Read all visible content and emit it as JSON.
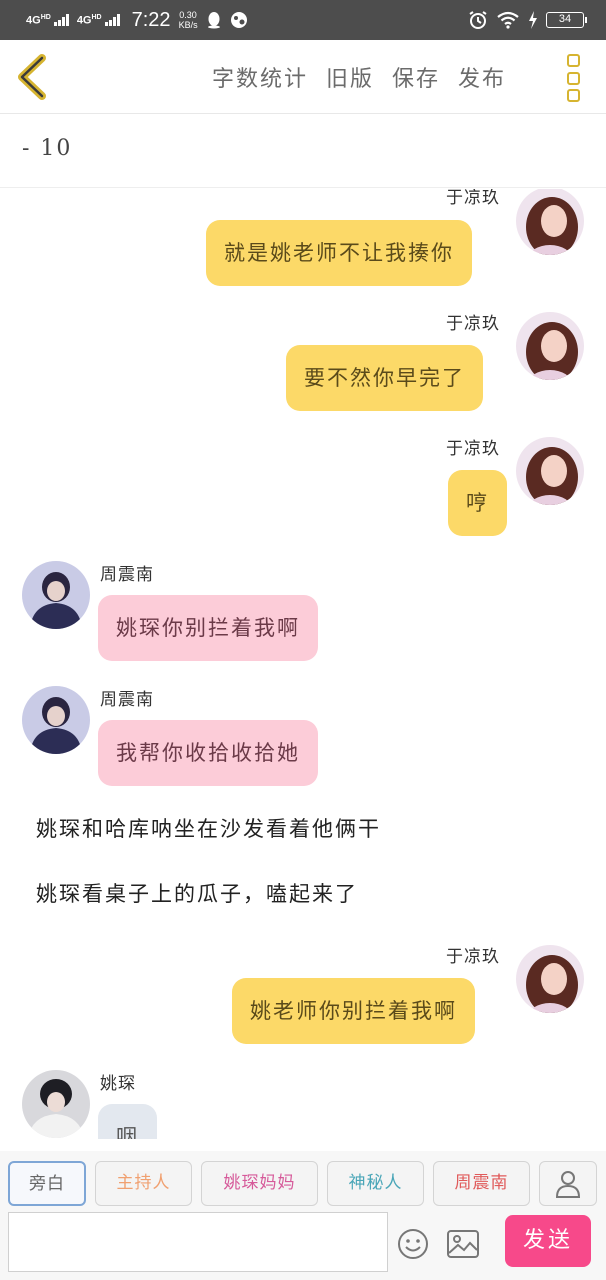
{
  "status_bar": {
    "network_1": "4G",
    "network_1_sup": "HD",
    "network_2": "4G",
    "network_2_sup": "HD",
    "time": "7:22",
    "speed_value": "0.30",
    "speed_unit": "KB/s",
    "battery": "34"
  },
  "nav": {
    "word_count": "字数统计",
    "old_version": "旧版",
    "save": "保存",
    "publish": "发布"
  },
  "title_field": {
    "value": "- 10"
  },
  "colors": {
    "accent": "#fcd968",
    "pink": "#fcccd8",
    "send": "#f7498a",
    "menu": "#d6b430"
  },
  "messages": [
    {
      "speaker": "于凉玖",
      "text": "就是姚老师不让我揍你",
      "side": "right"
    },
    {
      "speaker": "于凉玖",
      "text": "要不然你早完了",
      "side": "right"
    },
    {
      "speaker": "于凉玖",
      "text": "哼",
      "side": "right"
    },
    {
      "speaker": "周震南",
      "text": "姚琛你别拦着我啊",
      "side": "left"
    },
    {
      "speaker": "周震南",
      "text": "我帮你收拾收拾她",
      "side": "left"
    },
    {
      "narration": "姚琛和哈库呐坐在沙发看着他俩干"
    },
    {
      "narration": "姚琛看桌子上的瓜子，嗑起来了"
    },
    {
      "speaker": "于凉玖",
      "text": "姚老师你别拦着我啊",
      "side": "right"
    },
    {
      "speaker": "姚琛",
      "text": "咽",
      "side": "left"
    }
  ],
  "roles": [
    {
      "label": "旁白",
      "color": "#666666"
    },
    {
      "label": "主持人",
      "color": "#f0a070"
    },
    {
      "label": "姚琛妈妈",
      "color": "#d65a9a"
    },
    {
      "label": "神秘人",
      "color": "#4aa6b8"
    },
    {
      "label": "周震南",
      "color": "#e05a5a"
    }
  ],
  "input": {
    "value": "",
    "placeholder": ""
  },
  "send_label": "发送"
}
